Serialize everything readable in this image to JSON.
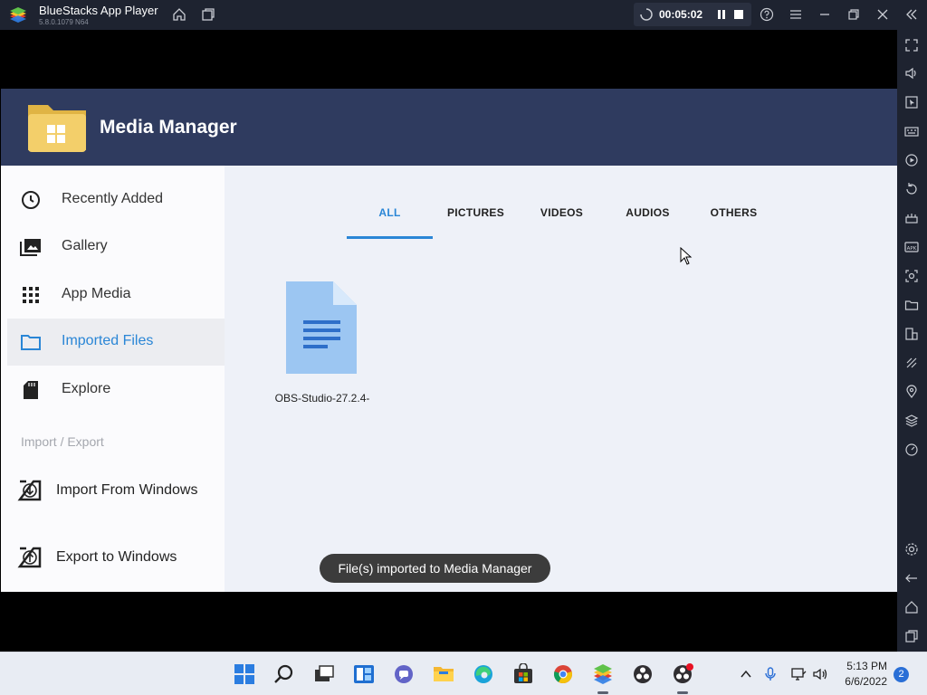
{
  "window": {
    "title": "BlueStacks App Player",
    "version": "5.8.0.1079 N64",
    "record_time": "00:05:02"
  },
  "app": {
    "title": "Media Manager"
  },
  "sidebar": {
    "items": [
      {
        "label": "Recently Added",
        "icon": "clock-icon"
      },
      {
        "label": "Gallery",
        "icon": "gallery-icon"
      },
      {
        "label": "App Media",
        "icon": "grid-icon"
      },
      {
        "label": "Imported Files",
        "icon": "folder-icon",
        "active": true
      },
      {
        "label": "Explore",
        "icon": "sd-card-icon"
      }
    ],
    "section_label": "Import / Export",
    "import_label": "Import From Windows",
    "export_label": "Export to Windows"
  },
  "tabs": [
    {
      "label": "ALL",
      "active": true
    },
    {
      "label": "PICTURES"
    },
    {
      "label": "VIDEOS"
    },
    {
      "label": "AUDIOS"
    },
    {
      "label": "OTHERS"
    }
  ],
  "files": [
    {
      "name": "OBS-Studio-27.2.4-",
      "icon": "document-icon"
    }
  ],
  "toast": "File(s) imported to Media Manager",
  "taskbar": {
    "time": "5:13 PM",
    "date": "6/6/2022",
    "notification_count": "2"
  },
  "colors": {
    "accent": "#2a86d6",
    "header": "#2f3b5f",
    "titlebar": "#1e2330"
  }
}
